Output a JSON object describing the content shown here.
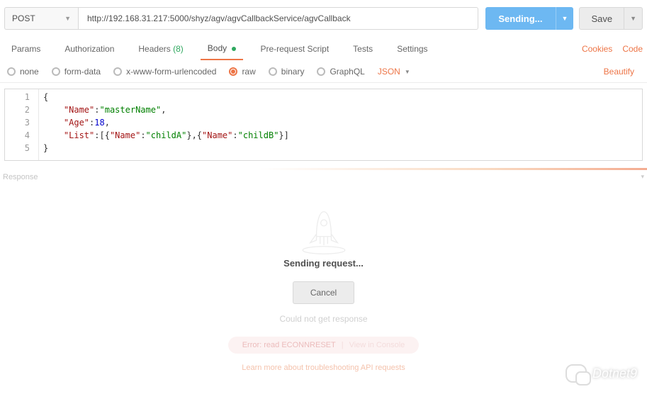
{
  "request": {
    "method": "POST",
    "url": "http://192.168.31.217:5000/shyz/agv/agvCallbackService/agvCallback",
    "send_label": "Sending...",
    "save_label": "Save"
  },
  "tabs": {
    "params": "Params",
    "authorization": "Authorization",
    "headers": "Headers",
    "headers_count": "(8)",
    "body": "Body",
    "prerequest": "Pre-request Script",
    "tests": "Tests",
    "settings": "Settings",
    "cookies": "Cookies",
    "code": "Code"
  },
  "body_types": {
    "none": "none",
    "formdata": "form-data",
    "xwww": "x-www-form-urlencoded",
    "raw": "raw",
    "binary": "binary",
    "graphql": "GraphQL",
    "format": "JSON",
    "beautify": "Beautify"
  },
  "editor": {
    "lines": [
      "1",
      "2",
      "3",
      "4",
      "5"
    ],
    "code": {
      "l1_brace": "{",
      "l2_key": "\"Name\"",
      "l2_val": "\"masterName\"",
      "l3_key": "\"Age\"",
      "l3_val": "18",
      "l4_key": "\"List\"",
      "l4_arr_k1": "\"Name\"",
      "l4_arr_v1": "\"childA\"",
      "l4_arr_k2": "\"Name\"",
      "l4_arr_v2": "\"childB\"",
      "l5_brace": "}"
    }
  },
  "response": {
    "label": "Response",
    "sending": "Sending request...",
    "cancel": "Cancel",
    "couldnot": "Could not get response",
    "error": "Error: read ECONNRESET",
    "console": "View in Console",
    "learn": "Learn more about troubleshooting API requests"
  },
  "watermark": "Dotnet9"
}
